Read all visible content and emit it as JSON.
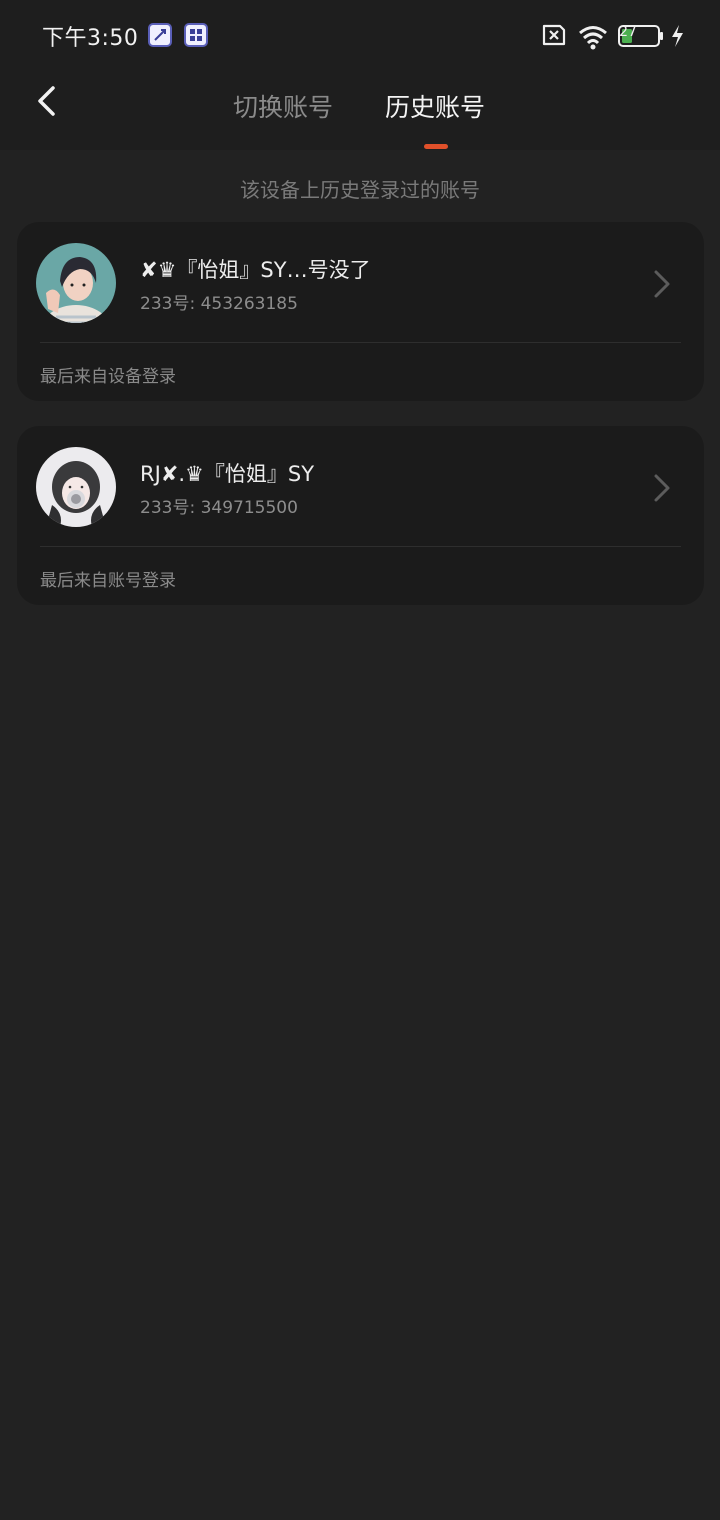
{
  "status_bar": {
    "time": "下午3:50",
    "battery": "27"
  },
  "header": {
    "tabs": [
      {
        "label": "切换账号"
      },
      {
        "label": "历史账号"
      }
    ],
    "accent_color": "#e0502a"
  },
  "subtitle": "该设备上历史登录过的账号",
  "accounts": [
    {
      "name": "✘♛『怡姐』SY…号没了",
      "id": "233号: 453263185",
      "source": "最后来自设备登录"
    },
    {
      "name": "RJ✘.♛『怡姐』SY",
      "id": "233号: 349715500",
      "source": "最后来自账号登录"
    }
  ],
  "icons": [
    "back-icon",
    "chevron-right-icon",
    "wifi-icon",
    "battery-icon",
    "charging-icon",
    "sim-error-icon"
  ]
}
